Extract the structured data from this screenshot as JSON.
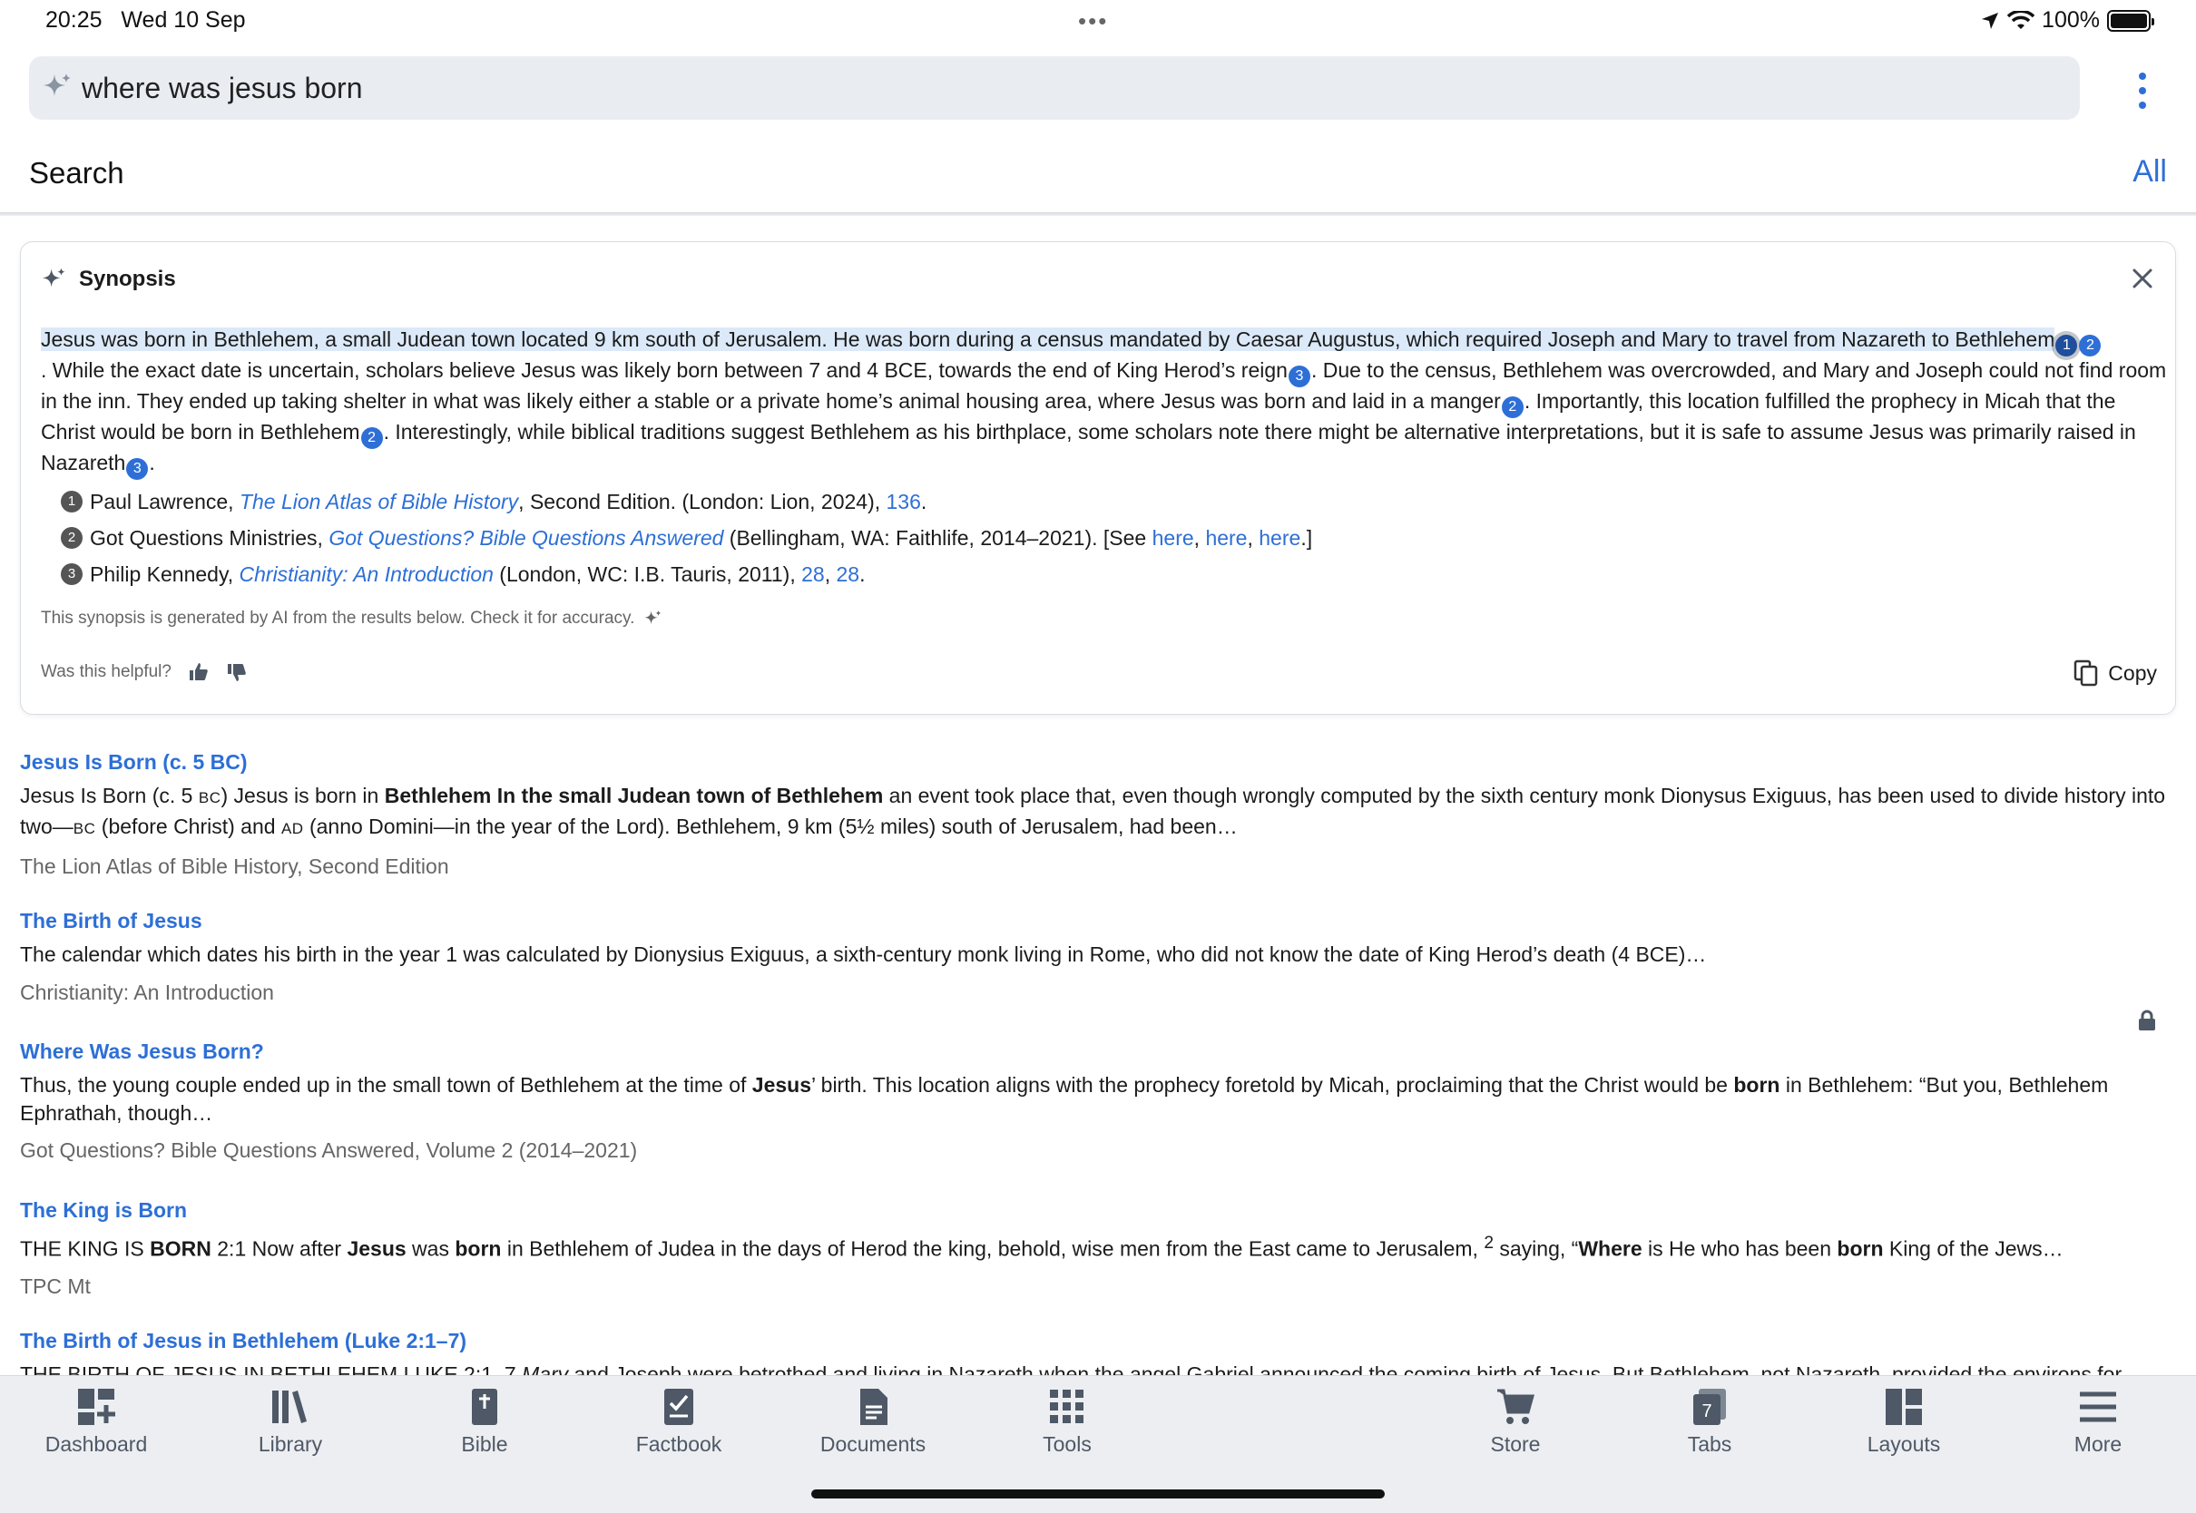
{
  "status_bar": {
    "time": "20:25",
    "date": "Wed 10 Sep",
    "dots": "•••",
    "battery": "100%"
  },
  "search": {
    "value": "where was jesus born",
    "placeholder": ""
  },
  "header": {
    "title": "Search",
    "filter_label": "All"
  },
  "synopsis": {
    "title": "Synopsis",
    "p1": "Jesus was born in Bethlehem, a small Judean town located 9 km south of Jerusalem. He was born during a census mandated by Caesar Augustus, which required Joseph and Mary to travel from Nazareth to Bethlehem",
    "c1a": "1",
    "c1b": "2",
    "p2": ". While the exact date is uncertain, scholars believe Jesus was likely born between 7 and 4 BCE, towards the end of King Herod’s reign",
    "c2": "3",
    "p3": ". Due to the census, Bethlehem was overcrowded, and Mary and Joseph could not find room in the inn. They ended up taking shelter in what was likely either a stable or a private home’s animal housing area, where Jesus was born and laid in a manger",
    "c3": "2",
    "p4": ". Importantly, this location fulfilled the prophecy in Micah that the Christ would be born in Bethlehem",
    "c4": "2",
    "p5": ". Interestingly, while biblical traditions suggest Bethlehem as his birthplace, some scholars note there might be alternative interpretations, but it is safe to assume Jesus was primarily raised in Nazareth",
    "c5": "3",
    "p6": ".",
    "refs": [
      {
        "num": "1",
        "author": "Paul Lawrence, ",
        "book": "The Lion Atlas of Bible History",
        "details": ", Second Edition. (London: Lion, 2024), ",
        "l1": "136",
        "tail": "."
      },
      {
        "num": "2",
        "author": "Got Questions Ministries, ",
        "book": "Got Questions? Bible Questions Answered",
        "details": " (Bellingham, WA: Faithlife, 2014–2021). [See ",
        "l1": "here",
        "l2": "here",
        "l3": "here",
        "tail": ".]"
      },
      {
        "num": "3",
        "author": "Philip Kennedy, ",
        "book": "Christianity: An Introduction",
        "details": " (London, WC: I.B. Tauris, 2011), ",
        "l1": "28",
        "l2": "28",
        "tail": "."
      }
    ],
    "note": "This synopsis is generated by AI from the results below. Check it for accuracy.",
    "helpful_label": "Was this helpful?",
    "copy_label": "Copy"
  },
  "results": [
    {
      "title": "Jesus Is Born (c. 5 BC)",
      "s1": "Jesus Is Born (c. 5 ",
      "s1sc": "BC",
      "s2": ") Jesus is born in ",
      "b1": "Bethlehem In the small Judean town of Bethlehem",
      "s3": " an event took place that, even though wrongly computed by the sixth century monk Dionysus Exiguus, has been used to divide history into two—",
      "s3sc": "BC",
      "s4": " (before Christ) and ",
      "s4sc": "AD",
      "s5": " (anno Domini—in the year of the Lord). Bethlehem, 9 km (5½ miles) south of Jerusalem, had been…",
      "source": "The Lion Atlas of Bible History, Second Edition"
    },
    {
      "title": "The Birth of Jesus",
      "snippet": "The calendar which dates his birth in the year 1 was calculated by Dionysius Exiguus, a sixth-century monk living in Rome, who did not know the date of King Herod’s death (4 BCE)…",
      "source": "Christianity: An Introduction"
    },
    {
      "title": "Where Was Jesus Born?",
      "s1": "Thus, the young couple ended up in the small town of Bethlehem at the time of ",
      "b1": "Jesus",
      "s2": "’ birth. This location aligns with the prophecy foretold by Micah, proclaiming that the Christ would be ",
      "b2": "born",
      "s3": " in Bethlehem: “But you, Bethlehem Ephrathah, though…",
      "source": "Got Questions? Bible Questions Answered, Volume 2 (2014–2021)"
    },
    {
      "title": "The King is Born",
      "s1": "THE KING IS ",
      "b1": "BORN",
      "s2": " 2:1 Now after ",
      "b2": "Jesus",
      "s3": " was ",
      "b3": "born",
      "s4": " in Bethlehem of Judea in the days of Herod the king, behold, wise men from the East came to Jerusalem, ",
      "sup": "2",
      "s5": " saying, “",
      "b4": "Where",
      "s6": " is He who has been ",
      "b5": "born",
      "s7": " King of the Jews…",
      "source": "TPC Mt"
    },
    {
      "title": "The Birth of Jesus in Bethlehem (Luke 2:1–7)",
      "s1": "THE BIRTH OF JESUS IN BETHLEHEM LUKE 2:1–7 ",
      "i1": "Mary",
      "s2": " and Joseph were betrothed and living in Nazareth when the angel Gabriel announced the coming birth of Jesus. But Bethlehem, not Nazareth, provided the environs for"
    }
  ],
  "tabs": [
    {
      "label": "Dashboard",
      "icon": "dashboard-icon"
    },
    {
      "label": "Library",
      "icon": "library-icon"
    },
    {
      "label": "Bible",
      "icon": "bible-icon"
    },
    {
      "label": "Factbook",
      "icon": "factbook-icon"
    },
    {
      "label": "Documents",
      "icon": "documents-icon"
    },
    {
      "label": "Tools",
      "icon": "tools-icon"
    },
    {
      "label": "Store",
      "icon": "store-icon"
    },
    {
      "label": "Tabs",
      "icon": "tabs-icon",
      "badge": "7"
    },
    {
      "label": "Layouts",
      "icon": "layouts-icon"
    },
    {
      "label": "More",
      "icon": "more-icon"
    }
  ],
  "colors": {
    "accent": "#2d6fd6",
    "highlight": "#dbe9f8",
    "tab_icon": "#4e5866"
  }
}
